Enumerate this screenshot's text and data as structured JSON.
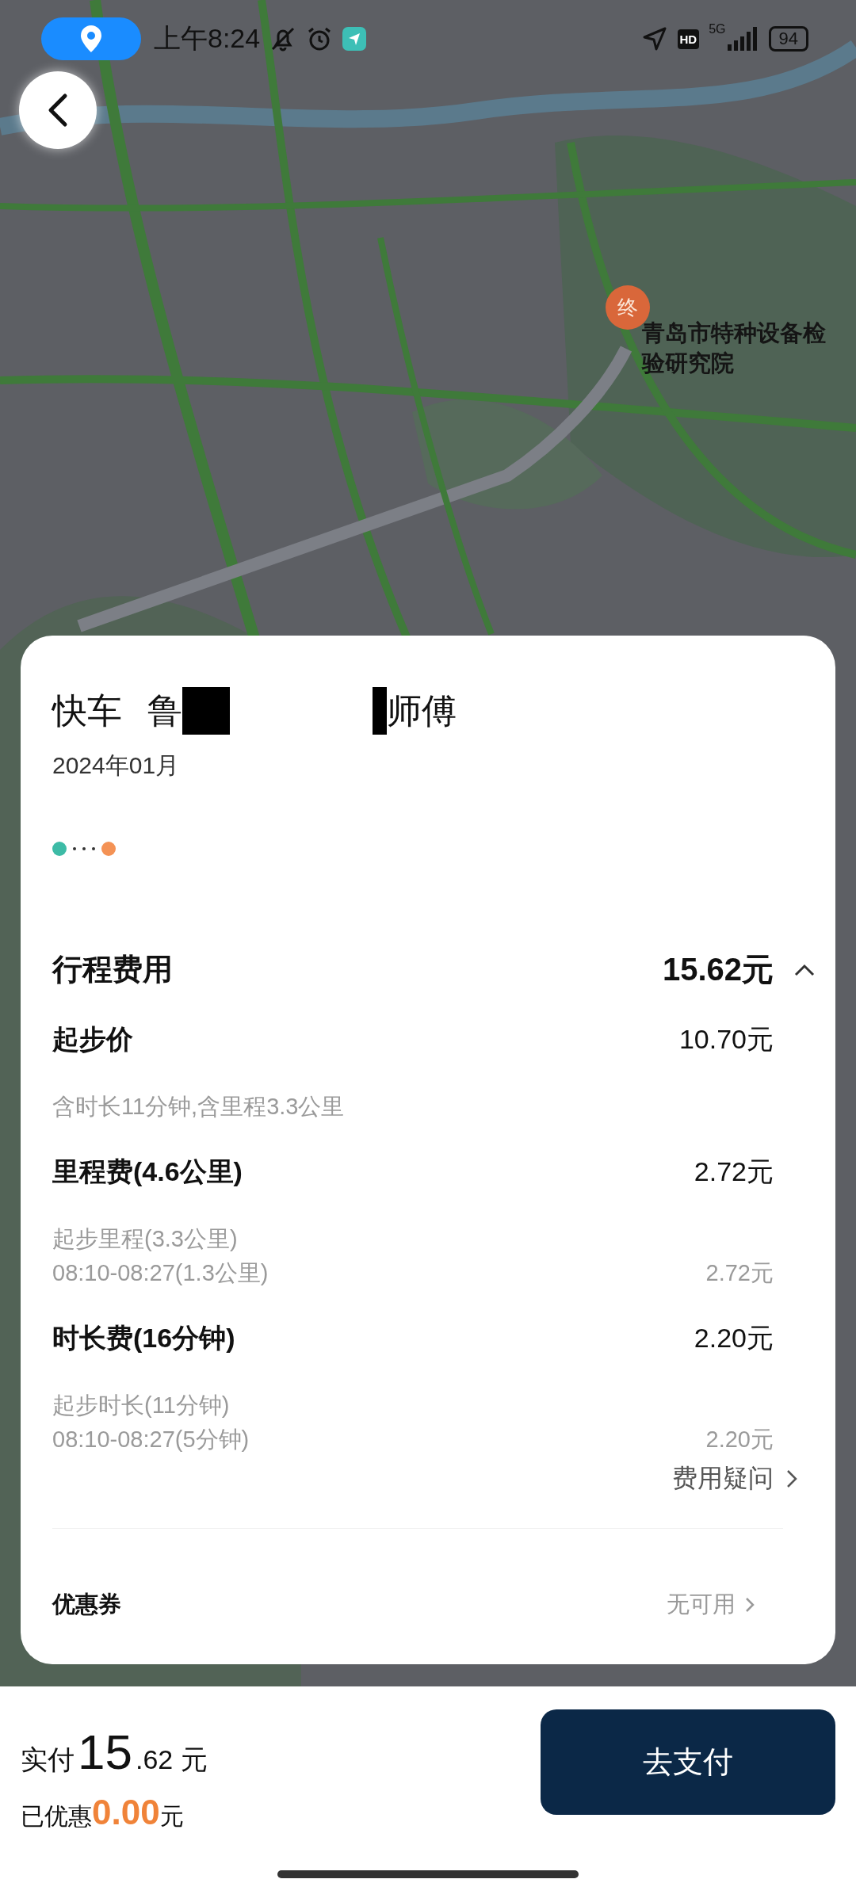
{
  "status_bar": {
    "time": "上午8:24",
    "network": "5G",
    "hd": "HD",
    "battery": "94"
  },
  "map": {
    "destination_marker": "终",
    "destination_name": "青岛市特种设备检验研究院"
  },
  "trip": {
    "service": "快车",
    "driver_parts": [
      "鲁",
      "师傅"
    ],
    "date": "2024年01月"
  },
  "fare": {
    "title": "行程费用",
    "total": "15.62元",
    "expanded": true,
    "items": [
      {
        "label": "起步价",
        "amount": "10.70元",
        "details": [
          {
            "text": "含时长11分钟,含里程3.3公里"
          }
        ]
      },
      {
        "label": "里程费(4.6公里)",
        "amount": "2.72元",
        "details": [
          {
            "text": "起步里程(3.3公里)"
          },
          {
            "text": "08:10-08:27(1.3公里)",
            "amount": "2.72元"
          }
        ]
      },
      {
        "label": "时长费(16分钟)",
        "amount": "2.20元",
        "details": [
          {
            "text": "起步时长(11分钟)"
          },
          {
            "text": "08:10-08:27(5分钟)",
            "amount": "2.20元"
          }
        ]
      }
    ],
    "question_link": "费用疑问"
  },
  "coupon": {
    "label": "优惠券",
    "value": "无可用"
  },
  "footer": {
    "paid_label": "实付",
    "paid_integer": "15",
    "paid_decimal": ".62",
    "currency": "元",
    "discount_label": "已优惠",
    "discount": "0.00",
    "discount_unit": "元",
    "pay_button": "去支付"
  }
}
